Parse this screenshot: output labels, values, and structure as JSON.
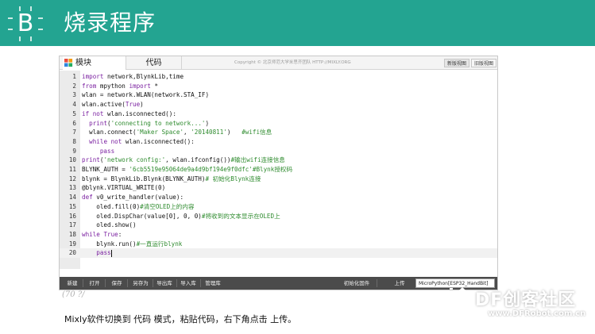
{
  "slide": {
    "badge_letter": "B",
    "title": "烧录程序",
    "header_color": "#23a491"
  },
  "ide": {
    "tabs": [
      {
        "label": "模块",
        "active": true
      },
      {
        "label": "代码",
        "active": false
      }
    ],
    "copyright": "Copyright © 北京师范大学米思齐团队 HTTP://MIXLY.ORG",
    "view_buttons": [
      "新版视图",
      "旧版视图"
    ],
    "code_lines": [
      {
        "n": "1",
        "text": "import network,BlynkLib,time"
      },
      {
        "n": "2",
        "text": "from mpython import *"
      },
      {
        "n": "3",
        "text": "wlan = network.WLAN(network.STA_IF)"
      },
      {
        "n": "4",
        "text": "wlan.active(True)"
      },
      {
        "n": "5",
        "text": "if not wlan.isconnected():"
      },
      {
        "n": "6",
        "text": "  print('connecting to network...')"
      },
      {
        "n": "7",
        "text": "  wlan.connect('Maker Space', '20140811')   #wifi信息"
      },
      {
        "n": "8",
        "text": "  while not wlan.isconnected():"
      },
      {
        "n": "9",
        "text": "     pass"
      },
      {
        "n": "10",
        "text": "print('network config:', wlan.ifconfig())#输出wifi连接信息"
      },
      {
        "n": "11",
        "text": "BLYNK_AUTH = '6cb5519e95064de9a4d9bf194e9f0dfc'#Blynk授权码"
      },
      {
        "n": "12",
        "text": "blynk = BlynkLib.Blynk(BLYNK_AUTH)# 初始化Blynk连接"
      },
      {
        "n": "13",
        "text": "@blynk.VIRTUAL_WRITE(0)"
      },
      {
        "n": "14",
        "text": "def v0_write_handler(value):"
      },
      {
        "n": "15",
        "text": "    oled.fill(0)#清空OLED上的内容"
      },
      {
        "n": "16",
        "text": "    oled.DispChar(value[0], 0, 0)#将收到的文本显示在OLED上"
      },
      {
        "n": "17",
        "text": "    oled.show()"
      },
      {
        "n": "18",
        "text": "while True:"
      },
      {
        "n": "19",
        "text": "    blynk.run()#一直运行blynk"
      },
      {
        "n": "20",
        "text": "    pass"
      }
    ],
    "syntax_colors": {
      "keyword": "#7a1fa0",
      "string": "#2e8b2e",
      "comment": "#2e8b2e",
      "text": "#111111"
    },
    "toolbar": {
      "buttons": [
        "新建",
        "打开",
        "保存",
        "另存为",
        "导出库",
        "导入库",
        "管理库",
        "初始化固件",
        "上传"
      ],
      "board": "MicroPython[ESP32_HandBit]",
      "bg": "#4b4b4b"
    }
  },
  "handwriting": "(70  ?/",
  "caption": "Mixly软件切换到 代码 模式，粘贴代码，右下角点击 上传。",
  "watermark": {
    "brand": "DF创客社区",
    "url": "www.DFRobot.com.cn"
  }
}
